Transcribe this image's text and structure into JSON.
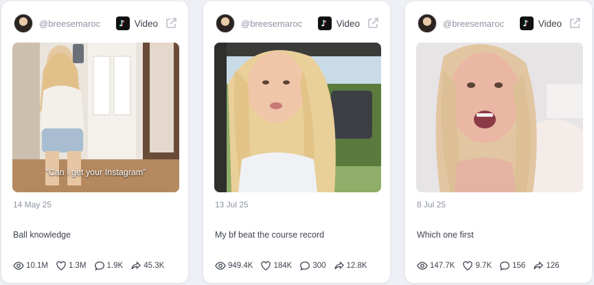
{
  "cards": [
    {
      "handle": "@breesemaroc",
      "platform_icon": "tiktok-icon",
      "type_label": "Video",
      "thumbnail_caption": "“Can I get your Instagram”",
      "date": "14 May 25",
      "title": "Ball knowledge",
      "stats": {
        "views": "10.1M",
        "likes": "1.3M",
        "comments": "1.9K",
        "shares": "45.3K"
      }
    },
    {
      "handle": "@breesemaroc",
      "platform_icon": "tiktok-icon",
      "type_label": "Video",
      "thumbnail_caption": "",
      "date": "13 Jul 25",
      "title": "My bf beat the course record",
      "stats": {
        "views": "949.4K",
        "likes": "184K",
        "comments": "300",
        "shares": "12.8K"
      }
    },
    {
      "handle": "@breesemaroc",
      "platform_icon": "tiktok-icon",
      "type_label": "Video",
      "thumbnail_caption": "",
      "date": "8 Jul 25",
      "title": "Which one first",
      "stats": {
        "views": "147.7K",
        "likes": "9.7K",
        "comments": "156",
        "shares": "126"
      }
    }
  ],
  "colors": {
    "page_background": "#eef0f5",
    "card_background": "#ffffff",
    "muted_text": "#8d93a0",
    "body_text": "#3f4450"
  }
}
